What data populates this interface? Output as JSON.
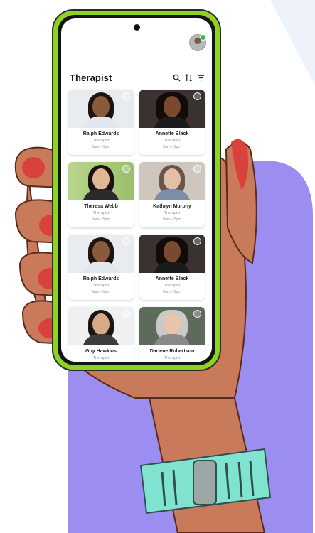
{
  "header": {
    "title": "Therapist",
    "icons": [
      "search-icon",
      "sort-icon",
      "filter-icon"
    ]
  },
  "therapists": [
    {
      "name": "Ralph Edwards",
      "role": "Therapist",
      "hours": "9am - 5pm"
    },
    {
      "name": "Annette Black",
      "role": "Therapist",
      "hours": "9am - 5pm"
    },
    {
      "name": "Theresa Webb",
      "role": "Therapist",
      "hours": "9am - 5pm"
    },
    {
      "name": "Kathryn Murphy",
      "role": "Therapist",
      "hours": "9am - 5pm"
    },
    {
      "name": "Ralph Edwards",
      "role": "Therapist",
      "hours": "9am - 5pm"
    },
    {
      "name": "Annette Black",
      "role": "Therapist",
      "hours": "9am - 5pm"
    },
    {
      "name": "Guy Hawkins",
      "role": "Therapist",
      "hours": ""
    },
    {
      "name": "Darlene Robertson",
      "role": "Therapist",
      "hours": ""
    }
  ],
  "colors": {
    "phone_frame": "#8ed321",
    "background_shape": "#9b8ef0",
    "hand_skin": "#c97a5a",
    "nails": "#d9423c",
    "band": "#7fe3cf",
    "online_status": "#27c340"
  }
}
